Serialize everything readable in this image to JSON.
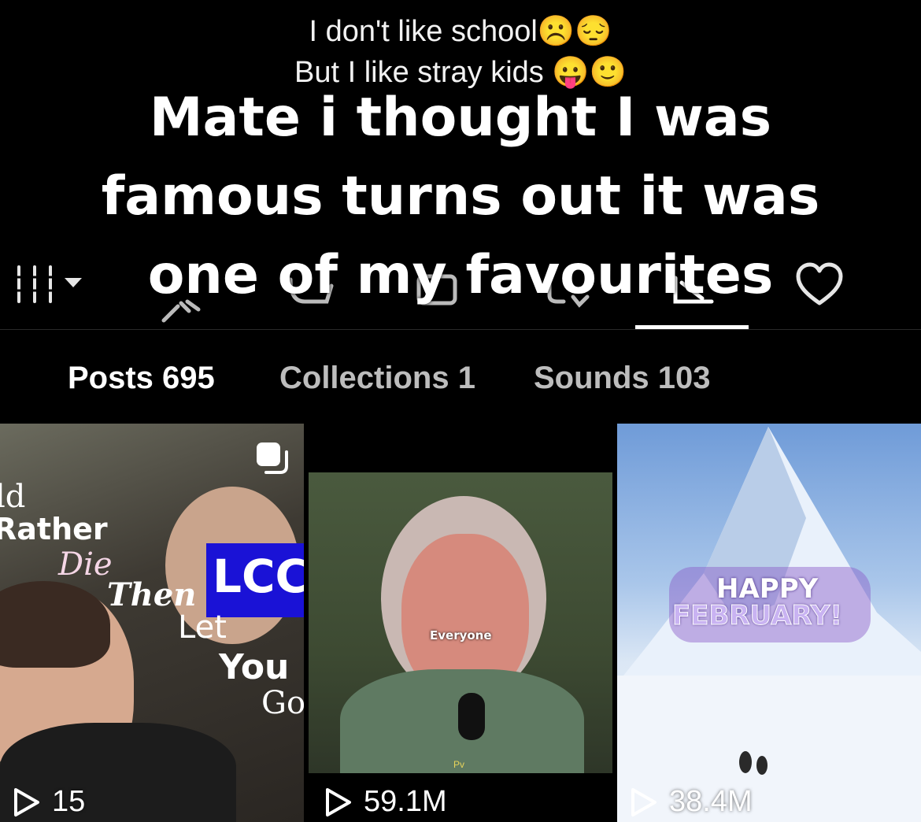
{
  "profile": {
    "bio_lines": [
      "I don't like school☹️😔",
      "But I like stray kids 😛🙂"
    ]
  },
  "video_overlay": {
    "lines": [
      "Mate i thought I was",
      "famous turns out it was",
      "one of my favourites"
    ]
  },
  "tab_icons": [
    "grid-icon",
    "dropdown-caret-icon",
    "repost-icon",
    "favorites-icon",
    "locked-icon",
    "private-icon",
    "liked-icon",
    "heart-icon"
  ],
  "subtabs": [
    {
      "label": "Posts 695"
    },
    {
      "label": "Collections 1"
    },
    {
      "label": "Sounds 103"
    }
  ],
  "videos": [
    {
      "views": "15",
      "text_lines": [
        "ld",
        "Rather",
        "Die",
        "Then",
        "LCC",
        "Let",
        "You",
        "Go"
      ],
      "pinned_icon": "multi-photo-icon"
    },
    {
      "views": "59.1M",
      "caption": "Everyone",
      "watermark": "Pv"
    },
    {
      "views": "38.4M",
      "text_lines": [
        "HAPPY",
        "FEBRUARY!"
      ]
    }
  ],
  "colors": {
    "background": "#000000",
    "active_text": "#ffffff",
    "inactive_text": "#bdbdbd"
  }
}
